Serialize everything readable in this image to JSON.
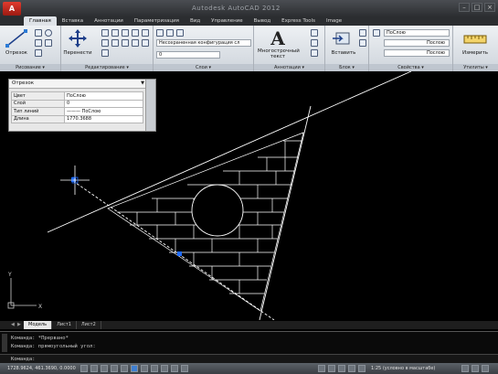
{
  "window": {
    "title": "Autodesk AutoCAD 2012",
    "logo_letter": "A",
    "controls": [
      "–",
      "□",
      "×"
    ]
  },
  "ribbon_tabs": [
    "Главная",
    "Вставка",
    "Аннотации",
    "Параметризация",
    "Вид",
    "Управление",
    "Вывод",
    "Express Tools",
    "Image"
  ],
  "active_tab_index": 0,
  "ribbon": {
    "draw": {
      "title": "Рисование ▾",
      "line_button": "Отрезок"
    },
    "modify": {
      "title": "Редактирование ▾",
      "move_button": "Перенести"
    },
    "layers": {
      "title": "Слои ▾",
      "state_combo": "Несохраненная конфигурация сл",
      "layer_combo": "0"
    },
    "annotation": {
      "title": "Аннотации ▾",
      "text_button": "Многострочный текст"
    },
    "block": {
      "title": "Блок ▾",
      "insert_button": "Вставить"
    },
    "properties": {
      "title": "Свойства ▾",
      "color_combo": "ПоСлою",
      "linetype_combo": "Послою",
      "lineweight_combo": "Послою"
    },
    "utilities": {
      "title": "Утилиты ▾",
      "measure_button": "Измерить"
    }
  },
  "properties_palette": {
    "selection": "Отрезок",
    "rows": [
      {
        "key": "Цвет",
        "value": "ПоСлою"
      },
      {
        "key": "Слой",
        "value": "0"
      },
      {
        "key": "Тип линий",
        "value": "——— ПоСлою"
      },
      {
        "key": "Длина",
        "value": "1770.3688"
      }
    ]
  },
  "layout_tabs": [
    "Модель",
    "Лист1",
    "Лист2"
  ],
  "active_layout_index": 0,
  "command_history": [
    "Команда: *Прервано*",
    "Команда: прямоугольный угол:"
  ],
  "command_prompt": "Команда:",
  "status": {
    "coordinates": "1728.9624, 461.3690, 0.0000",
    "annotation_scale": "1:25 (условно в масштабе)"
  },
  "colors": {
    "canvas_bg": "#000000",
    "drawing_lines": "#ffffff",
    "grip": "#1f6bff",
    "ucs_icon": "#cfcfcf"
  },
  "icons": [
    "app-logo",
    "line-icon",
    "move-icon",
    "text-icon",
    "insert-icon",
    "measure-icon",
    "ucs-icon",
    "crosshair-cursor"
  ]
}
